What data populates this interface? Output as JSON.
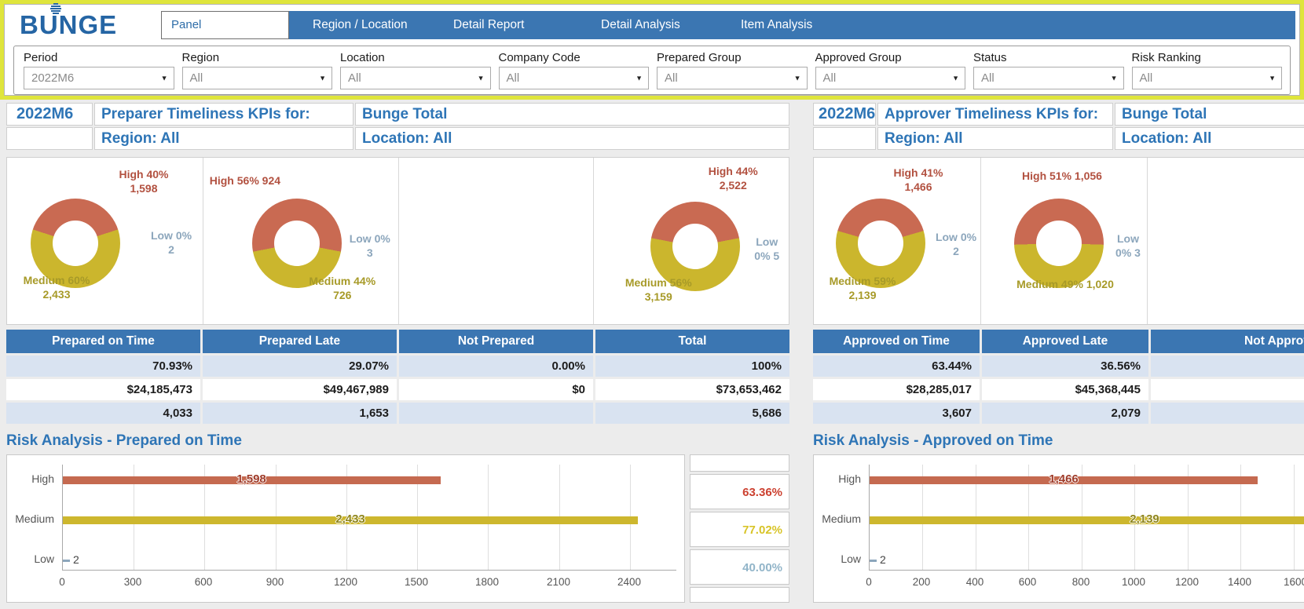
{
  "brand": {
    "name": "BUNGE"
  },
  "nav": {
    "tabs": [
      {
        "label": "Panel",
        "active": true
      },
      {
        "label": "Region / Location",
        "active": false
      },
      {
        "label": "Detail Report",
        "active": false
      },
      {
        "label": "Detail Analysis",
        "active": false
      },
      {
        "label": "Item Analysis",
        "active": false
      }
    ]
  },
  "filters": [
    {
      "label": "Period",
      "value": "2022M6"
    },
    {
      "label": "Region",
      "value": "All"
    },
    {
      "label": "Location",
      "value": "All"
    },
    {
      "label": "Company Code",
      "value": "All"
    },
    {
      "label": "Prepared Group",
      "value": "All"
    },
    {
      "label": "Approved Group",
      "value": "All"
    },
    {
      "label": "Status",
      "value": "All"
    },
    {
      "label": "Risk Ranking",
      "value": "All"
    }
  ],
  "colors": {
    "nav_blue": "#3B76B2",
    "title_blue": "#2E75B6",
    "highlight_yellow": "#DFE53C",
    "donut_high_red": "#C96A52",
    "donut_medium_yellow": "#CBB62D",
    "low_blue": "#8CA6BC",
    "table_row_blue": "#D9E3F1",
    "pct_red": "#CC4130",
    "pct_yellow": "#D8C428",
    "pct_blue": "#92B5C9"
  },
  "left": {
    "period": "2022M6",
    "title": "Preparer Timeliness KPIs for:",
    "entity": "Bunge Total",
    "region": "Region: All",
    "location": "Location: All",
    "donuts": [
      {
        "name": "Prepared on Time",
        "high_pct": 40,
        "high_line1": "High 40%",
        "high_line2": "1,598",
        "low_line1": "Low 0%",
        "low_line2": "2",
        "med_line1": "Medium 60%",
        "med_line2": "2,433"
      },
      {
        "name": "Prepared Late",
        "high_pct": 56,
        "high_line1": "High 56% 924",
        "high_line2": "",
        "low_line1": "Low 0%",
        "low_line2": "3",
        "med_line1": "Medium 44%",
        "med_line2": "726"
      },
      {
        "name": "Total",
        "high_pct": 44,
        "high_line1": "High 44%",
        "high_line2": "2,522",
        "low_line1": "Low",
        "low_line2": "0% 5",
        "med_line1": "Medium 56%",
        "med_line2": "3,159"
      }
    ],
    "table": {
      "headers": [
        "Prepared on Time",
        "Prepared Late",
        "Not Prepared",
        "Total"
      ],
      "rows": [
        [
          "70.93%",
          "29.07%",
          "0.00%",
          "100%"
        ],
        [
          "$24,185,473",
          "$49,467,989",
          "$0",
          "$73,653,462"
        ],
        [
          "4,033",
          "1,653",
          "",
          "5,686"
        ]
      ]
    },
    "risk": {
      "title": "Risk Analysis - Prepared on Time",
      "type": "bar",
      "categories": [
        "High",
        "Medium",
        "Low"
      ],
      "values": [
        1598,
        2433,
        2
      ],
      "bar_label_high": "1,598",
      "bar_label_med": "2,433",
      "bar_label_low": "2",
      "axis_max": 2600,
      "x_ticks": [
        "0",
        "300",
        "600",
        "900",
        "1200",
        "1500",
        "1800",
        "2100",
        "2400"
      ],
      "percents": [
        "63.36%",
        "77.02%",
        "40.00%"
      ]
    }
  },
  "right": {
    "period": "2022M6",
    "title": "Approver Timeliness KPIs for:",
    "entity": "Bunge Total",
    "region": "Region: All",
    "location": "Location: All",
    "donuts": [
      {
        "name": "Approved on Time",
        "high_pct": 41,
        "high_line1": "High 41%",
        "high_line2": "1,466",
        "low_line1": "Low 0%",
        "low_line2": "2",
        "med_line1": "Medium 59%",
        "med_line2": "2,139"
      },
      {
        "name": "Approved Late",
        "high_pct": 51,
        "high_line1": "High 51% 1,056",
        "high_line2": "",
        "low_line1": "Low",
        "low_line2": "0% 3",
        "med_line1": "Medium 49% 1,020",
        "med_line2": ""
      }
    ],
    "table": {
      "headers": [
        "Approved on Time",
        "Approved Late",
        "Not Approved"
      ],
      "rows": [
        [
          "63.44%",
          "36.56%",
          ""
        ],
        [
          "$28,285,017",
          "$45,368,445",
          ""
        ],
        [
          "3,607",
          "2,079",
          ""
        ]
      ]
    },
    "risk": {
      "title": "Risk Analysis - Approved on Time",
      "type": "bar",
      "categories": [
        "High",
        "Medium",
        "Low"
      ],
      "values": [
        1466,
        2139,
        2
      ],
      "bar_label_high": "1,466",
      "bar_label_med": "2,139",
      "bar_label_low": "2",
      "x_ticks": [
        "0",
        "200",
        "400",
        "600",
        "800",
        "1000",
        "1200",
        "1400",
        "1600"
      ]
    }
  }
}
